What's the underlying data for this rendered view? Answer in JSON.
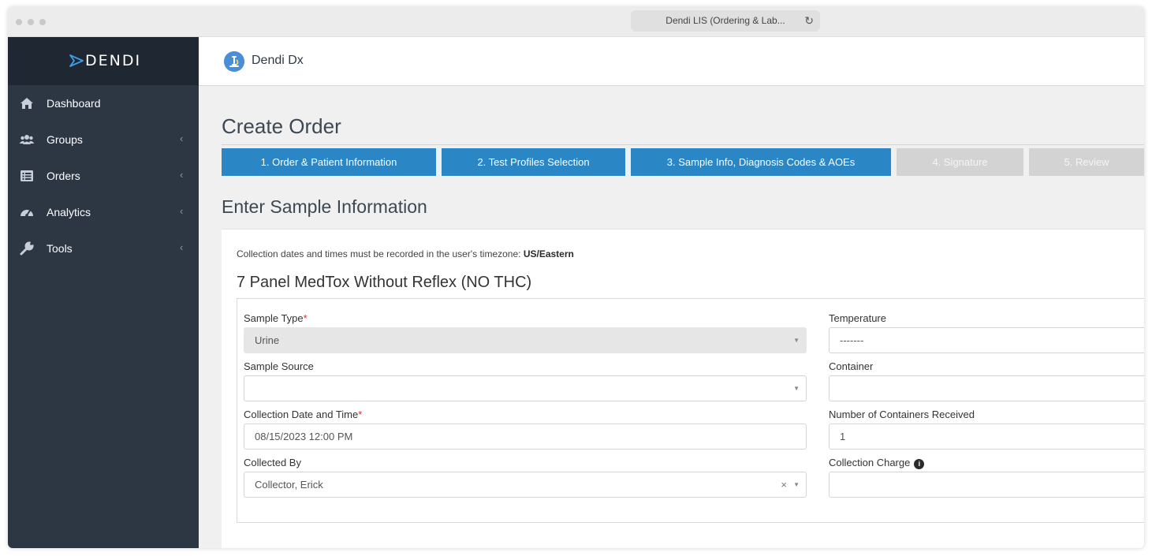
{
  "browser": {
    "tab_title": "Dendi LIS (Ordering & Lab...",
    "reload_icon": "reload-icon"
  },
  "sidebar": {
    "brand": "DENDI",
    "items": [
      {
        "label": "Dashboard",
        "icon": "home-icon",
        "has_caret": false
      },
      {
        "label": "Groups",
        "icon": "users-icon",
        "has_caret": true
      },
      {
        "label": "Orders",
        "icon": "list-icon",
        "has_caret": true
      },
      {
        "label": "Analytics",
        "icon": "dashboard-gauge-icon",
        "has_caret": true
      },
      {
        "label": "Tools",
        "icon": "wrench-icon",
        "has_caret": true
      }
    ],
    "caret": "‹"
  },
  "header": {
    "app_name": "Dendi Dx"
  },
  "page": {
    "title": "Create Order",
    "steps": [
      {
        "label": "1. Order & Patient Information",
        "active": true
      },
      {
        "label": "2. Test Profiles Selection",
        "active": true
      },
      {
        "label": "3. Sample Info, Diagnosis Codes & AOEs",
        "active": true
      },
      {
        "label": "4. Signature",
        "active": false
      },
      {
        "label": "5. Review",
        "active": false
      }
    ],
    "section_title": "Enter Sample Information"
  },
  "form": {
    "tz_note_prefix": "Collection dates and times must be recorded in the user's timezone:",
    "tz_value": "US/Eastern",
    "panel_title": "7 Panel MedTox Without Reflex (NO THC)",
    "sample_type": {
      "label": "Sample Type",
      "required_mark": "*",
      "value": "Urine"
    },
    "sample_source": {
      "label": "Sample Source",
      "value": ""
    },
    "collection_datetime": {
      "label": "Collection Date and Time",
      "required_mark": "*",
      "value": "08/15/2023 12:00 PM"
    },
    "collected_by": {
      "label": "Collected By",
      "value": "Collector, Erick",
      "clear": "×"
    },
    "temperature": {
      "label": "Temperature",
      "value": "-------"
    },
    "container": {
      "label": "Container",
      "value": ""
    },
    "num_containers": {
      "label": "Number of Containers Received",
      "value": "1"
    },
    "collection_charge": {
      "label": "Collection Charge",
      "value": "",
      "info": "i"
    },
    "dropdown_arrow": "▼"
  },
  "colors": {
    "sidebar_bg": "#2d3643",
    "brand_bg": "#1f2732",
    "step_active": "#2a86c4",
    "step_inactive": "#d3d3d3",
    "required": "#d32f2f"
  }
}
